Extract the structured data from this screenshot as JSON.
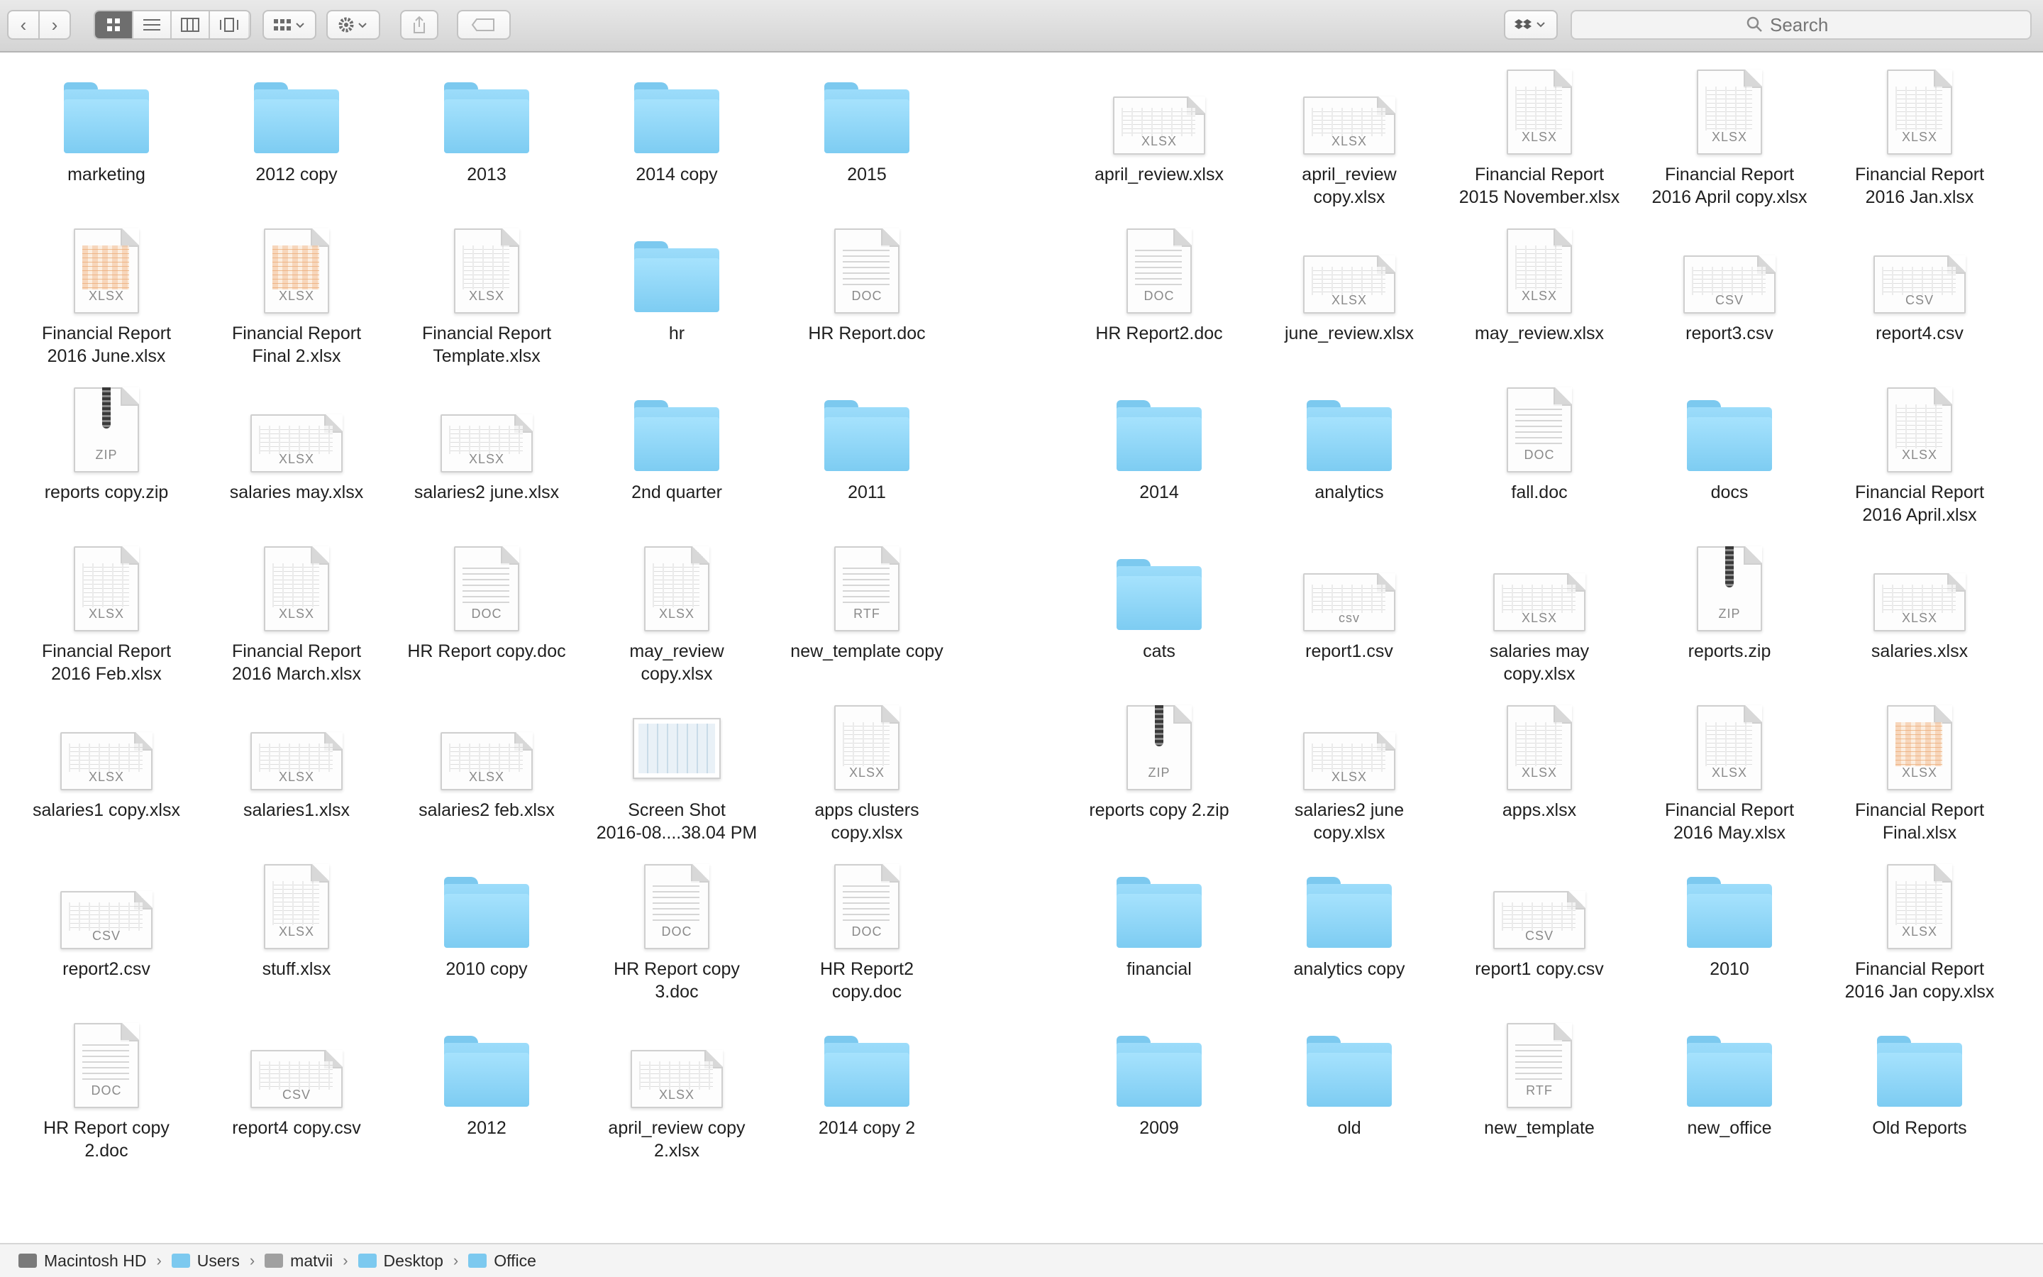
{
  "toolbar": {
    "back_icon": "chevron-left",
    "forward_icon": "chevron-right",
    "view_modes": [
      "icon-view",
      "list-view",
      "column-view",
      "cover-flow-view"
    ],
    "active_view": "icon-view",
    "search_placeholder": "Search"
  },
  "items": [
    {
      "name": "marketing",
      "type": "folder"
    },
    {
      "name": "2012 copy",
      "type": "folder"
    },
    {
      "name": "2013",
      "type": "folder"
    },
    {
      "name": "2014 copy",
      "type": "folder"
    },
    {
      "name": "2015",
      "type": "folder"
    },
    {
      "name": "april_review.xlsx",
      "type": "wide",
      "ext": "XLSX"
    },
    {
      "name": "april_review\ncopy.xlsx",
      "type": "wide",
      "ext": "XLSX"
    },
    {
      "name": "Financial Report\n2015 November.xlsx",
      "type": "sheet",
      "ext": "XLSX"
    },
    {
      "name": "Financial Report\n2016 April copy.xlsx",
      "type": "sheet",
      "ext": "XLSX"
    },
    {
      "name": "Financial Report\n2016 Jan.xlsx",
      "type": "sheet",
      "ext": "XLSX"
    },
    {
      "name": "Financial Report\n2016 June.xlsx",
      "type": "color",
      "ext": "XLSX"
    },
    {
      "name": "Financial Report\nFinal 2.xlsx",
      "type": "color",
      "ext": "XLSX"
    },
    {
      "name": "Financial Report\nTemplate.xlsx",
      "type": "sheet",
      "ext": "XLSX"
    },
    {
      "name": "hr",
      "type": "folder"
    },
    {
      "name": "HR Report.doc",
      "type": "doc",
      "ext": "DOC"
    },
    {
      "name": "HR Report2.doc",
      "type": "doc",
      "ext": "DOC"
    },
    {
      "name": "june_review.xlsx",
      "type": "wide",
      "ext": "XLSX"
    },
    {
      "name": "may_review.xlsx",
      "type": "sheet",
      "ext": "XLSX"
    },
    {
      "name": "report3.csv",
      "type": "wide",
      "ext": "CSV"
    },
    {
      "name": "report4.csv",
      "type": "wide",
      "ext": "CSV"
    },
    {
      "name": "reports copy.zip",
      "type": "zip",
      "ext": "ZIP"
    },
    {
      "name": "salaries may.xlsx",
      "type": "wide",
      "ext": "XLSX"
    },
    {
      "name": "salaries2 june.xlsx",
      "type": "wide",
      "ext": "XLSX"
    },
    {
      "name": "2nd quarter",
      "type": "folder"
    },
    {
      "name": "2011",
      "type": "folder"
    },
    {
      "name": "2014",
      "type": "folder"
    },
    {
      "name": "analytics",
      "type": "folder"
    },
    {
      "name": "fall.doc",
      "type": "doc",
      "ext": "DOC"
    },
    {
      "name": "docs",
      "type": "folder"
    },
    {
      "name": "Financial Report\n2016 April.xlsx",
      "type": "sheet",
      "ext": "XLSX"
    },
    {
      "name": "Financial Report\n2016 Feb.xlsx",
      "type": "sheet",
      "ext": "XLSX"
    },
    {
      "name": "Financial Report\n2016 March.xlsx",
      "type": "sheet",
      "ext": "XLSX"
    },
    {
      "name": "HR Report copy.doc",
      "type": "doc",
      "ext": "DOC"
    },
    {
      "name": "may_review\ncopy.xlsx",
      "type": "sheet",
      "ext": "XLSX"
    },
    {
      "name": "new_template copy",
      "type": "doc",
      "ext": "RTF"
    },
    {
      "name": "cats",
      "type": "folder"
    },
    {
      "name": "report1.csv",
      "type": "wide",
      "ext": "csv"
    },
    {
      "name": "salaries may\ncopy.xlsx",
      "type": "wide",
      "ext": "XLSX"
    },
    {
      "name": "reports.zip",
      "type": "zip",
      "ext": "ZIP"
    },
    {
      "name": "salaries.xlsx",
      "type": "wide",
      "ext": "XLSX"
    },
    {
      "name": "salaries1 copy.xlsx",
      "type": "wide",
      "ext": "XLSX"
    },
    {
      "name": "salaries1.xlsx",
      "type": "wide",
      "ext": "XLSX"
    },
    {
      "name": "salaries2 feb.xlsx",
      "type": "wide",
      "ext": "XLSX"
    },
    {
      "name": "Screen Shot\n2016-08....38.04 PM",
      "type": "shot"
    },
    {
      "name": "apps clusters\ncopy.xlsx",
      "type": "sheet",
      "ext": "XLSX"
    },
    {
      "name": "reports copy 2.zip",
      "type": "zip",
      "ext": "ZIP"
    },
    {
      "name": "salaries2 june\ncopy.xlsx",
      "type": "wide",
      "ext": "XLSX"
    },
    {
      "name": "apps.xlsx",
      "type": "sheet",
      "ext": "XLSX"
    },
    {
      "name": "Financial Report\n2016 May.xlsx",
      "type": "sheet",
      "ext": "XLSX"
    },
    {
      "name": "Financial Report\nFinal.xlsx",
      "type": "color",
      "ext": "XLSX"
    },
    {
      "name": "report2.csv",
      "type": "wide",
      "ext": "CSV"
    },
    {
      "name": "stuff.xlsx",
      "type": "sheet",
      "ext": "XLSX"
    },
    {
      "name": "2010 copy",
      "type": "folder"
    },
    {
      "name": "HR Report copy\n3.doc",
      "type": "doc",
      "ext": "DOC"
    },
    {
      "name": "HR Report2\ncopy.doc",
      "type": "doc",
      "ext": "DOC"
    },
    {
      "name": "financial",
      "type": "folder"
    },
    {
      "name": "analytics copy",
      "type": "folder"
    },
    {
      "name": "report1 copy.csv",
      "type": "wide",
      "ext": "CSV"
    },
    {
      "name": "2010",
      "type": "folder"
    },
    {
      "name": "Financial Report\n2016 Jan copy.xlsx",
      "type": "sheet",
      "ext": "XLSX"
    },
    {
      "name": "HR Report copy\n2.doc",
      "type": "doc",
      "ext": "DOC"
    },
    {
      "name": "report4 copy.csv",
      "type": "wide",
      "ext": "CSV"
    },
    {
      "name": "2012",
      "type": "folder"
    },
    {
      "name": "april_review copy\n2.xlsx",
      "type": "wide",
      "ext": "XLSX"
    },
    {
      "name": "2014 copy 2",
      "type": "folder"
    },
    {
      "name": "2009",
      "type": "folder"
    },
    {
      "name": "old",
      "type": "folder"
    },
    {
      "name": "new_template",
      "type": "doc",
      "ext": "RTF"
    },
    {
      "name": "new_office",
      "type": "folder"
    },
    {
      "name": "Old Reports",
      "type": "folder"
    }
  ],
  "pathbar": [
    {
      "label": "Macintosh HD",
      "icon": "hard-drive",
      "color": "#7a7a7a"
    },
    {
      "label": "Users",
      "icon": "folder",
      "color": "#7cc9ef"
    },
    {
      "label": "matvii",
      "icon": "home",
      "color": "#a0a0a0"
    },
    {
      "label": "Desktop",
      "icon": "folder",
      "color": "#7cc9ef"
    },
    {
      "label": "Office",
      "icon": "folder",
      "color": "#7cc9ef"
    }
  ]
}
